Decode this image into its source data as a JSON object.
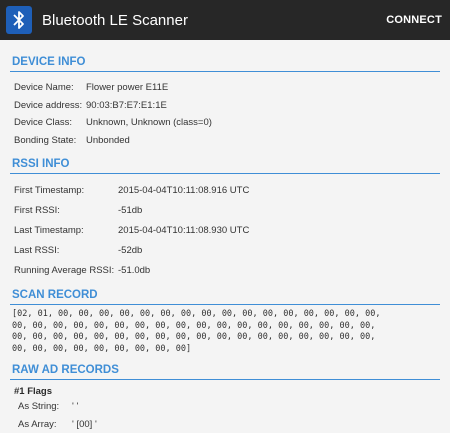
{
  "app": {
    "title": "Bluetooth LE Scanner",
    "icon": "bluetooth-icon",
    "action_label": "CONNECT"
  },
  "colors": {
    "actionbar_bg": "#272727",
    "accent": "#3f8ed6",
    "app_icon_bg": "#1e5fb8"
  },
  "device_info": {
    "header": "DEVICE INFO",
    "rows": [
      {
        "label": "Device Name:",
        "value": "Flower power E11E"
      },
      {
        "label": "Device address:",
        "value": "90:03:B7:E7:E1:1E"
      },
      {
        "label": "Device Class:",
        "value": "Unknown, Unknown (class=0)"
      },
      {
        "label": "Bonding State:",
        "value": "Unbonded"
      }
    ]
  },
  "rssi_info": {
    "header": "RSSI INFO",
    "rows": [
      {
        "label": "First Timestamp:",
        "value": "2015-04-04T10:11:08.916 UTC"
      },
      {
        "label": "First RSSI:",
        "value": "-51db"
      },
      {
        "label": "Last Timestamp:",
        "value": "2015-04-04T10:11:08.930 UTC"
      },
      {
        "label": "Last RSSI:",
        "value": "-52db"
      },
      {
        "label": "Running Average RSSI:",
        "value": "-51.0db"
      }
    ]
  },
  "scan_record": {
    "header": "SCAN RECORD",
    "lines": [
      "[02, 01, 00, 00, 00, 00, 00, 00, 00, 00, 00, 00, 00, 00, 00, 00, 00, 00,",
      "00, 00, 00, 00, 00, 00, 00, 00, 00, 00, 00, 00, 00, 00, 00, 00, 00, 00,",
      "00, 00, 00, 00, 00, 00, 00, 00, 00, 00, 00, 00, 00, 00, 00, 00, 00, 00,",
      "00, 00, 00, 00, 00, 00, 00, 00, 00]"
    ]
  },
  "raw_ad_records": {
    "header": "RAW AD RECORDS",
    "records": [
      {
        "title": "#1 Flags",
        "as_string_label": "As String:",
        "as_string_value": "' '",
        "as_array_label": "As Array:",
        "as_array_value": "' [00] '"
      }
    ]
  }
}
